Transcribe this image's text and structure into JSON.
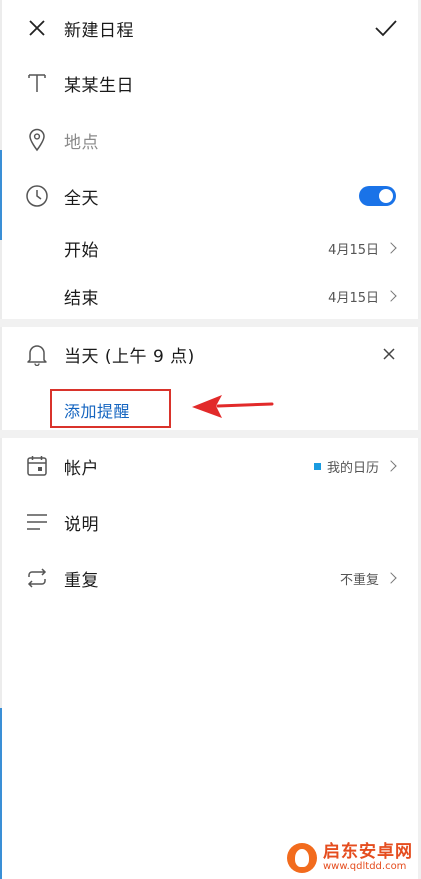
{
  "header": {
    "title": "新建日程"
  },
  "event": {
    "title": "某某生日",
    "location_placeholder": "地点"
  },
  "all_day": {
    "label": "全天",
    "enabled": true
  },
  "start": {
    "label": "开始",
    "value": "4月15日"
  },
  "end": {
    "label": "结束",
    "value": "4月15日"
  },
  "reminder": {
    "label": "当天 (上午 9 点)",
    "add_label": "添加提醒"
  },
  "account": {
    "label": "帐户",
    "value": "我的日历",
    "color": "#1a9be0"
  },
  "description": {
    "label": "说明"
  },
  "repeat": {
    "label": "重复",
    "value": "不重复"
  },
  "colors": {
    "accent": "#1a73e8",
    "annotation": "#d9332b"
  },
  "watermark": {
    "name": "启东安卓网",
    "url": "www.qdltdd.com"
  }
}
